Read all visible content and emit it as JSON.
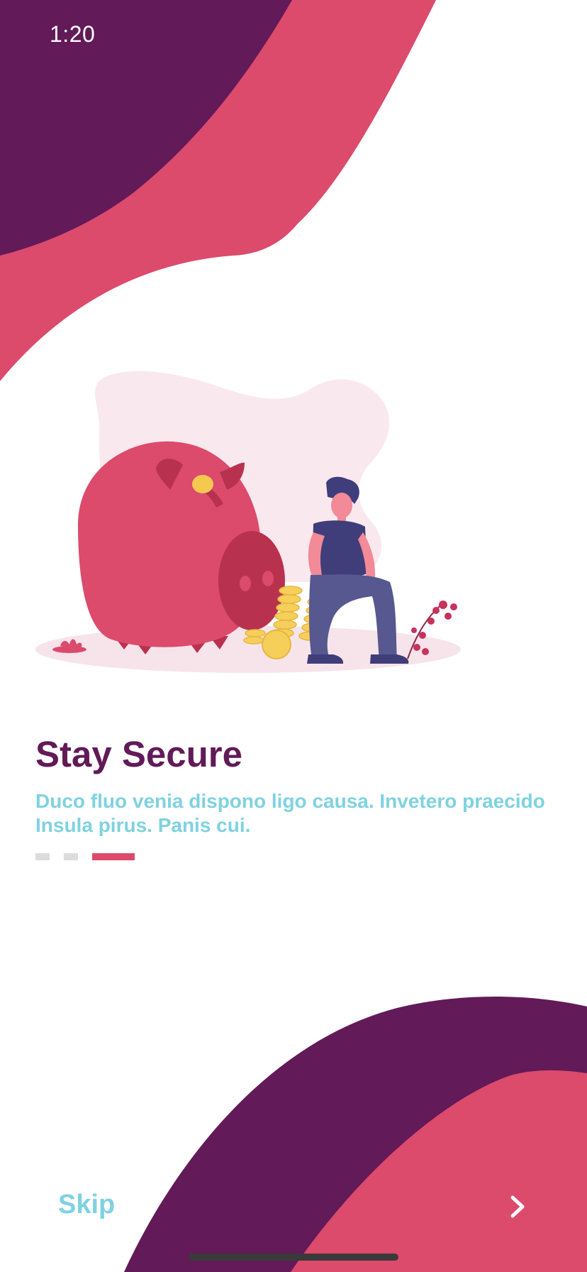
{
  "status_bar": {
    "time": "1:20"
  },
  "onboarding": {
    "title": "Stay Secure",
    "description": "Duco fluo venia dispono ligo causa. Invetero praecido Insula pirus. Panis cui.",
    "pager": {
      "total": 3,
      "active_index": 2
    }
  },
  "actions": {
    "skip_label": "Skip",
    "next_icon": "chevron-right-icon"
  },
  "colors": {
    "primary_dark": "#621a58",
    "accent_pink": "#dc4a6c",
    "text_cyan": "#7fd2e0",
    "pager_inactive": "#dcdcdc"
  }
}
